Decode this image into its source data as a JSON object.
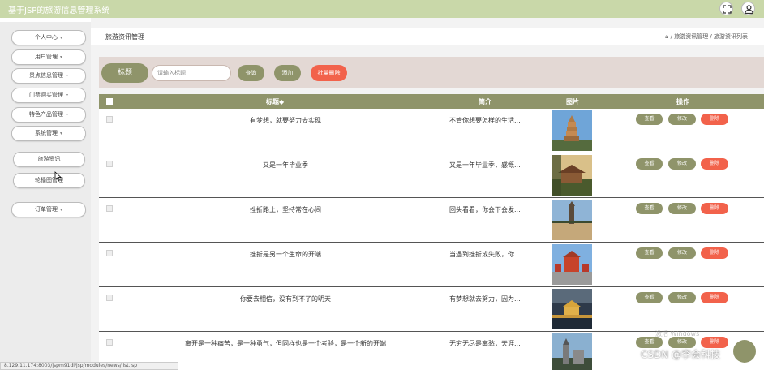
{
  "app": {
    "title": "基于JSP的旅游信息管理系统"
  },
  "header_icons": [
    "fullscreen-icon",
    "user-icon"
  ],
  "sidebar": {
    "items": [
      {
        "label": "个人中心",
        "caret": "▾"
      },
      {
        "label": "用户管理",
        "caret": "▾"
      },
      {
        "label": "景点信息管理",
        "caret": "▾"
      },
      {
        "label": "门票购买管理",
        "caret": "▾"
      },
      {
        "label": "特色产品管理",
        "caret": "▾"
      },
      {
        "label": "系统管理",
        "caret": "▾"
      },
      {
        "label": "旅游资讯",
        "caret": ""
      },
      {
        "label": "轮播图管理",
        "caret": ""
      },
      {
        "label": "订单管理",
        "caret": "▾"
      }
    ]
  },
  "breadcrumb": {
    "page_title": "旅游资讯管理",
    "trail": "⌂ / 旅游资讯管理 / 旅游资讯列表"
  },
  "search": {
    "label": "标题",
    "placeholder": "请输入标题",
    "query_button": "查询",
    "add_button": "添加",
    "batch_delete_button": "批量删除"
  },
  "table": {
    "headers": {
      "title": "标题◆",
      "intro": "简介",
      "image": "图片",
      "actions": "操作"
    },
    "action_labels": {
      "view": "查看",
      "edit": "修改",
      "delete": "删除"
    },
    "rows": [
      {
        "title": "有梦想，就要努力去实现",
        "intro": "不管你想要怎样的生活...",
        "image": "pagoda-photo"
      },
      {
        "title": "又是一年毕业季",
        "intro": "又是一年毕业季，感慨...",
        "image": "temple-photo"
      },
      {
        "title": "挫折路上，坚持常在心间",
        "intro": "回头看看，你会下会发...",
        "image": "tower-lake-photo"
      },
      {
        "title": "挫折是另一个生命的开端",
        "intro": "当遇到挫折或失败，你...",
        "image": "pavilion-photo"
      },
      {
        "title": "你要去相信，没有到不了的明天",
        "intro": "有梦想就去努力，因为...",
        "image": "bridge-photo"
      },
      {
        "title": "离开是一种痛苦，是一种勇气，但同样也是一个考验，是一个新的开端",
        "intro": "无穷无尽是离愁，天涯...",
        "image": "castle-photo"
      }
    ]
  },
  "status_url": "8.129.11.174:8003/jspm91di/jsp/modules/news/list.jsp",
  "os_watermark": "激活 Windows",
  "watermark": "CSDN @李会科技",
  "colors": {
    "accent": "#8f946a",
    "danger": "#f2624b",
    "topbar": "#c9d8a9",
    "search_bg": "#e3d8d4"
  }
}
